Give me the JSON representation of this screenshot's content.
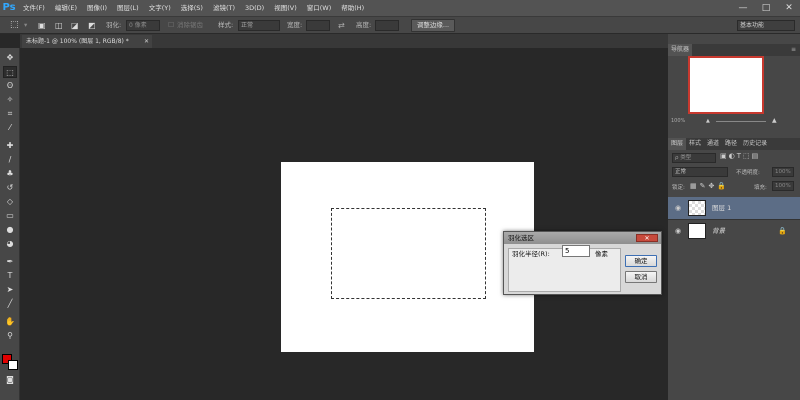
{
  "app": {
    "logo": "Ps"
  },
  "menu": [
    "文件(F)",
    "编辑(E)",
    "图像(I)",
    "图层(L)",
    "文字(Y)",
    "选择(S)",
    "滤镜(T)",
    "3D(D)",
    "视图(V)",
    "窗口(W)",
    "帮助(H)"
  ],
  "window_controls": {
    "minimize": "—",
    "maximize": "□",
    "close": "✕"
  },
  "options": {
    "feather_label": "羽化:",
    "feather_value": "0 像素",
    "antialias_label": "消除锯齿",
    "style_label": "样式:",
    "style_value": "正常",
    "width_label": "宽度:",
    "height_label": "高度:",
    "refine_edge_button": "调整边缘...",
    "workspace_value": "基本功能"
  },
  "document": {
    "tab_title": "未标题-1 @ 100% (图层 1, RGB/8) *",
    "tab_close": "✕"
  },
  "navigator": {
    "tab": "导航器",
    "zoom": "100%"
  },
  "layers": {
    "tabs": [
      "图层",
      "样式",
      "通道",
      "路径",
      "历史记录"
    ],
    "filter_kind": "ρ 类型",
    "blend_mode": "正常",
    "opacity_label": "不透明度:",
    "opacity_value": "100%",
    "lock_label": "锁定:",
    "fill_label": "填充:",
    "fill_value": "100%",
    "items": [
      {
        "name": "图层 1",
        "selected": true
      },
      {
        "name": "背景",
        "selected": false,
        "locked": true
      }
    ]
  },
  "dialog": {
    "title": "羽化选区",
    "radius_label": "羽化半径(R):",
    "radius_value": "5",
    "unit": "像素",
    "ok_button": "确定",
    "cancel_button": "取消",
    "close": "✕"
  },
  "colors": {
    "foreground": "#e00000",
    "background": "#ffffff",
    "selected_layer": "#5c6d86",
    "accent": "#31a8ff"
  }
}
